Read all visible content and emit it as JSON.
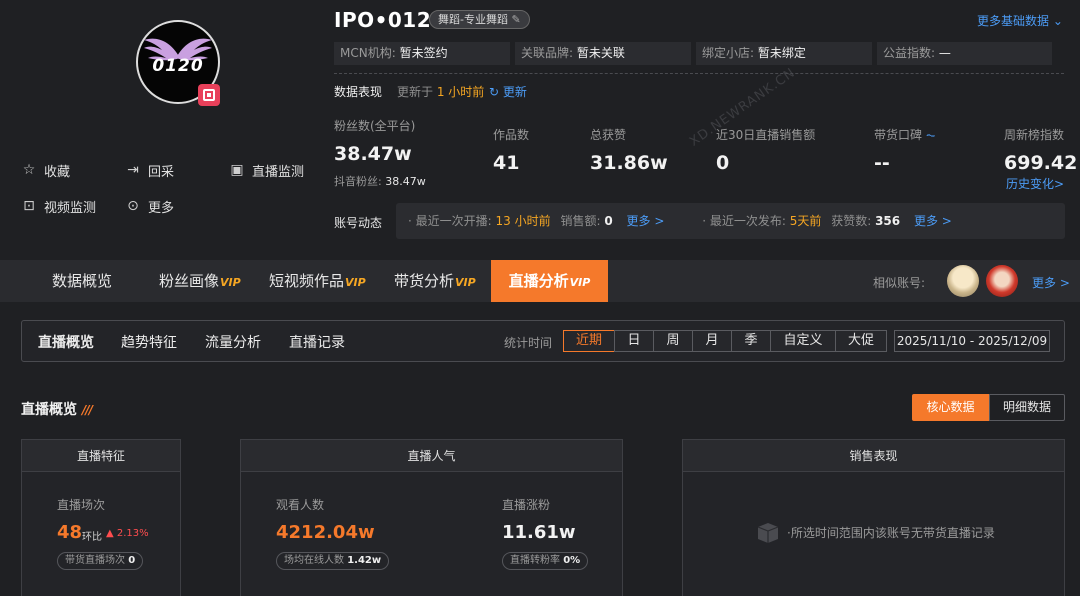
{
  "account": {
    "name": "IPO•0120",
    "tag": "舞蹈-专业舞蹈",
    "more_base_data": "更多基础数据",
    "avatar_text": "0120"
  },
  "actions": {
    "favorite": "收藏",
    "recollect": "回采",
    "live_monitor": "直播监测",
    "video_monitor": "视频监测",
    "more": "更多"
  },
  "info": {
    "mcn_label": "MCN机构:",
    "mcn_value": "暂未签约",
    "brand_label": "关联品牌:",
    "brand_value": "暂未关联",
    "shop_label": "绑定小店:",
    "shop_value": "暂未绑定",
    "charity_label": "公益指数:",
    "charity_value": "—"
  },
  "performance": {
    "label": "数据表现",
    "updated_prefix": "更新于",
    "updated_value": "1 小时前",
    "refresh": "更新"
  },
  "stats": {
    "fans_label": "粉丝数(全平台)",
    "fans_value": "38.47w",
    "douyin_fans_label": "抖音粉丝:",
    "douyin_fans_value": "38.47w",
    "works_label": "作品数",
    "works_value": "41",
    "likes_label": "总获赞",
    "likes_value": "31.86w",
    "sales30_label": "近30日直播销售额",
    "sales30_value": "0",
    "reputation_label": "带货口碑",
    "reputation_value": "--",
    "weekly_label": "周新榜指数",
    "weekly_value": "699.42",
    "history_link": "历史变化>"
  },
  "dynamics": {
    "label": "账号动态",
    "last_live_label": "· 最近一次开播:",
    "last_live_value": "13 小时前",
    "sales_label": "销售额:",
    "sales_value": "0",
    "more1": "更多 >",
    "last_post_label": "· 最近一次发布:",
    "last_post_value": "5天前",
    "likes_label": "获赞数:",
    "likes_value": "356",
    "more2": "更多 >"
  },
  "nav": {
    "tabs": [
      {
        "label": "数据概览",
        "vip": ""
      },
      {
        "label": "粉丝画像",
        "vip": "VIP"
      },
      {
        "label": "短视频作品",
        "vip": "VIP"
      },
      {
        "label": "带货分析",
        "vip": "VIP"
      },
      {
        "label": "直播分析",
        "vip": "VIP"
      }
    ],
    "similar_label": "相似账号:",
    "similar_more": "更多 >"
  },
  "subnav": {
    "items": [
      "直播概览",
      "趋势特征",
      "流量分析",
      "直播记录"
    ],
    "time_label": "统计时间",
    "segments": [
      "近期",
      "日",
      "周",
      "月",
      "季",
      "自定义",
      "大促"
    ],
    "date_range": "2025/11/10 - 2025/12/09"
  },
  "overview": {
    "title": "直播概览",
    "core_button": "核心数据",
    "detail_button": "明细数据"
  },
  "cards": {
    "features": {
      "head": "直播特征",
      "sessions_label": "直播场次",
      "sessions_value": "48",
      "ratio_label": "环比",
      "ratio_value": "▲ 2.13%",
      "sales_sessions_label": "带货直播场次",
      "sales_sessions_value": "0"
    },
    "popularity": {
      "head": "直播人气",
      "viewers_label": "观看人数",
      "viewers_value": "4212.04w",
      "avg_online_label": "场均在线人数",
      "avg_online_value": "1.42w",
      "growth_label": "直播涨粉",
      "growth_value": "11.61w",
      "conversion_label": "直播转粉率",
      "conversion_value": "0%"
    },
    "sales": {
      "head": "销售表现",
      "empty_text": "所选时间范围内该账号无带货直播记录"
    }
  },
  "watermark": "XD.NEWRANK.CN",
  "colors": {
    "accent": "#f5792b",
    "link": "#4c9cf6",
    "highlight": "#f5a623",
    "up": "#ff4d4f"
  }
}
